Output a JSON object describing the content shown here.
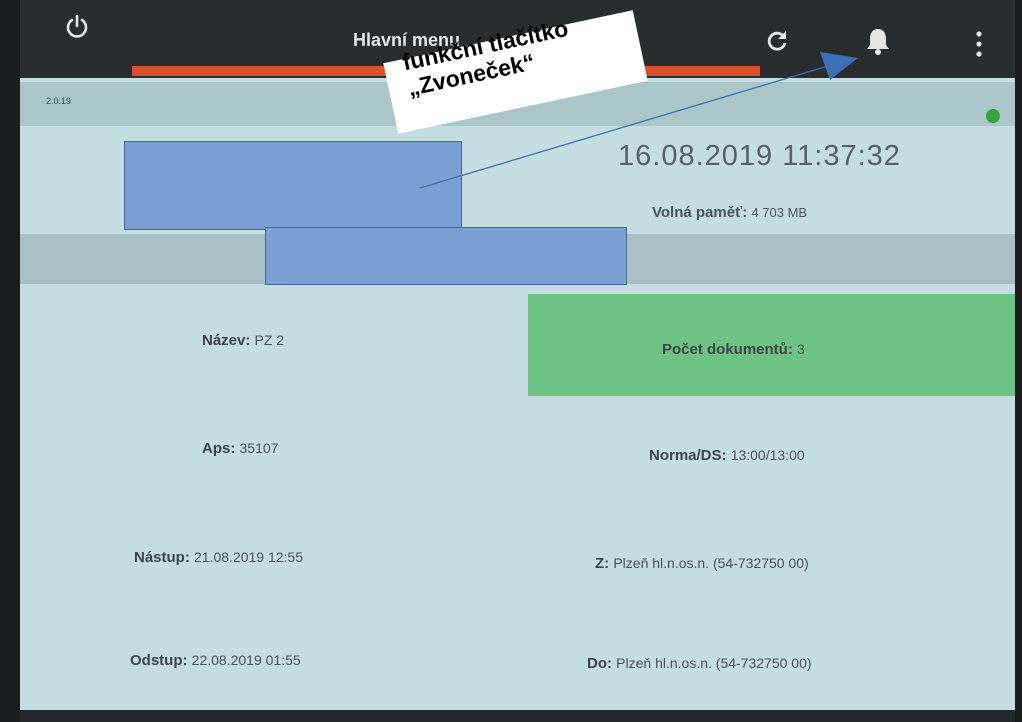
{
  "header": {
    "title": "Hlavní menu",
    "icons": [
      "power-icon",
      "refresh-icon",
      "bell-icon",
      "more-vert-icon"
    ]
  },
  "version": "2.0.19",
  "datetime": "16.08.2019 11:37:32",
  "memory": {
    "label": "Volná paměť:",
    "value": "4 703 MB"
  },
  "annotation": {
    "line1": "funkční tlačítko",
    "line2": "„Zvoneček“"
  },
  "fields": {
    "nazev": {
      "label": "Název:",
      "value": "PZ 2"
    },
    "dokumenty": {
      "label": "Počet dokumentů:",
      "value": "3"
    },
    "aps": {
      "label": "Aps:",
      "value": "35107"
    },
    "norma": {
      "label": "Norma/DS:",
      "value": "13:00/13:00"
    },
    "nastup": {
      "label": "Nástup:",
      "value": "21.08.2019 12:55"
    },
    "z": {
      "label": "Z:",
      "value": "Plzeň hl.n.os.n. (54-732750 00)"
    },
    "odstup": {
      "label": "Odstup:",
      "value": "22.08.2019 01:55"
    },
    "do": {
      "label": "Do:",
      "value": "Plzeň hl.n.os.n. (54-732750 00)"
    }
  },
  "colors": {
    "topbar": "#2a2d2e",
    "accent": "#d9502a",
    "status": "#34a33c",
    "doc_box": "#6dc383",
    "background": "#c4dde0",
    "annotation_arrow": "#3c6fb5"
  }
}
